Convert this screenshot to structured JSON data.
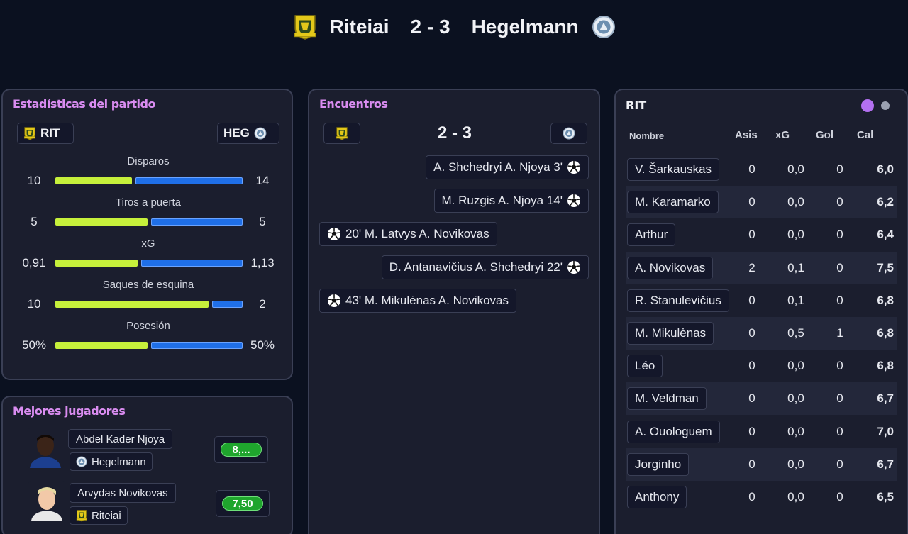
{
  "header": {
    "home_team": "Riteiai",
    "away_team": "Hegelmann",
    "score": "2 - 3"
  },
  "colors": {
    "home_bar": "#c6f03b",
    "away_bar": "#1f6fe8",
    "title": "#d98cf0",
    "rating_green": "#1fa52d"
  },
  "stats": {
    "title": "Estadísticas del partido",
    "home_abbr": "RIT",
    "away_abbr": "HEG",
    "rows": [
      {
        "label": "Disparos",
        "home": "10",
        "away": "14",
        "home_share": 0.4167
      },
      {
        "label": "Tiros a puerta",
        "home": "5",
        "away": "5",
        "home_share": 0.5
      },
      {
        "label": "xG",
        "home": "0,91",
        "away": "1,13",
        "home_share": 0.446
      },
      {
        "label": "Saques de esquina",
        "home": "10",
        "away": "2",
        "home_share": 0.8333
      },
      {
        "label": "Posesión",
        "home": "50%",
        "away": "50%",
        "home_share": 0.5
      }
    ]
  },
  "events": {
    "title": "Encuentros",
    "score": "2 - 3",
    "items": [
      {
        "side": "away",
        "text": "A. Shchedryi A. Njoya 3'",
        "icon": "soccer-ball-icon"
      },
      {
        "side": "away",
        "text": "M. Ruzgis A. Njoya 14'",
        "icon": "soccer-ball-icon"
      },
      {
        "side": "home",
        "text": "20' M. Latvys A. Novikovas",
        "icon": "soccer-ball-icon"
      },
      {
        "side": "away",
        "text": "D. Antanavičius A. Shchedryi 22'",
        "icon": "soccer-ball-icon"
      },
      {
        "side": "home",
        "text": "43' M. Mikulėnas A. Novikovas",
        "icon": "soccer-ball-icon"
      }
    ]
  },
  "best": {
    "title": "Mejores jugadores",
    "players": [
      {
        "name": "Abdel Kader Njoya",
        "team": "Hegelmann",
        "rating": "8,..."
      },
      {
        "name": "Arvydas Novikovas",
        "team": "Riteiai",
        "rating": "7,50"
      }
    ]
  },
  "lineup": {
    "team": "RIT",
    "headers": {
      "name": "Nombre",
      "assists": "Asis",
      "xg": "xG",
      "goals": "Gol",
      "rating": "Cal"
    },
    "players": [
      {
        "name": "V. Šarkauskas",
        "assists": "0",
        "xg": "0,0",
        "goals": "0",
        "rating": "6,0"
      },
      {
        "name": "M. Karamarko",
        "assists": "0",
        "xg": "0,0",
        "goals": "0",
        "rating": "6,2"
      },
      {
        "name": "Arthur",
        "assists": "0",
        "xg": "0,0",
        "goals": "0",
        "rating": "6,4"
      },
      {
        "name": "A. Novikovas",
        "assists": "2",
        "xg": "0,1",
        "goals": "0",
        "rating": "7,5"
      },
      {
        "name": "R. Stanulevičius",
        "assists": "0",
        "xg": "0,1",
        "goals": "0",
        "rating": "6,8"
      },
      {
        "name": "M. Mikulėnas",
        "assists": "0",
        "xg": "0,5",
        "goals": "1",
        "rating": "6,8"
      },
      {
        "name": "Léo",
        "assists": "0",
        "xg": "0,0",
        "goals": "0",
        "rating": "6,8"
      },
      {
        "name": "M. Veldman",
        "assists": "0",
        "xg": "0,0",
        "goals": "0",
        "rating": "6,7"
      },
      {
        "name": "A. Ouologuem",
        "assists": "0",
        "xg": "0,0",
        "goals": "0",
        "rating": "7,0"
      },
      {
        "name": "Jorginho",
        "assists": "0",
        "xg": "0,0",
        "goals": "0",
        "rating": "6,7"
      },
      {
        "name": "Anthony",
        "assists": "0",
        "xg": "0,0",
        "goals": "0",
        "rating": "6,5"
      }
    ]
  }
}
